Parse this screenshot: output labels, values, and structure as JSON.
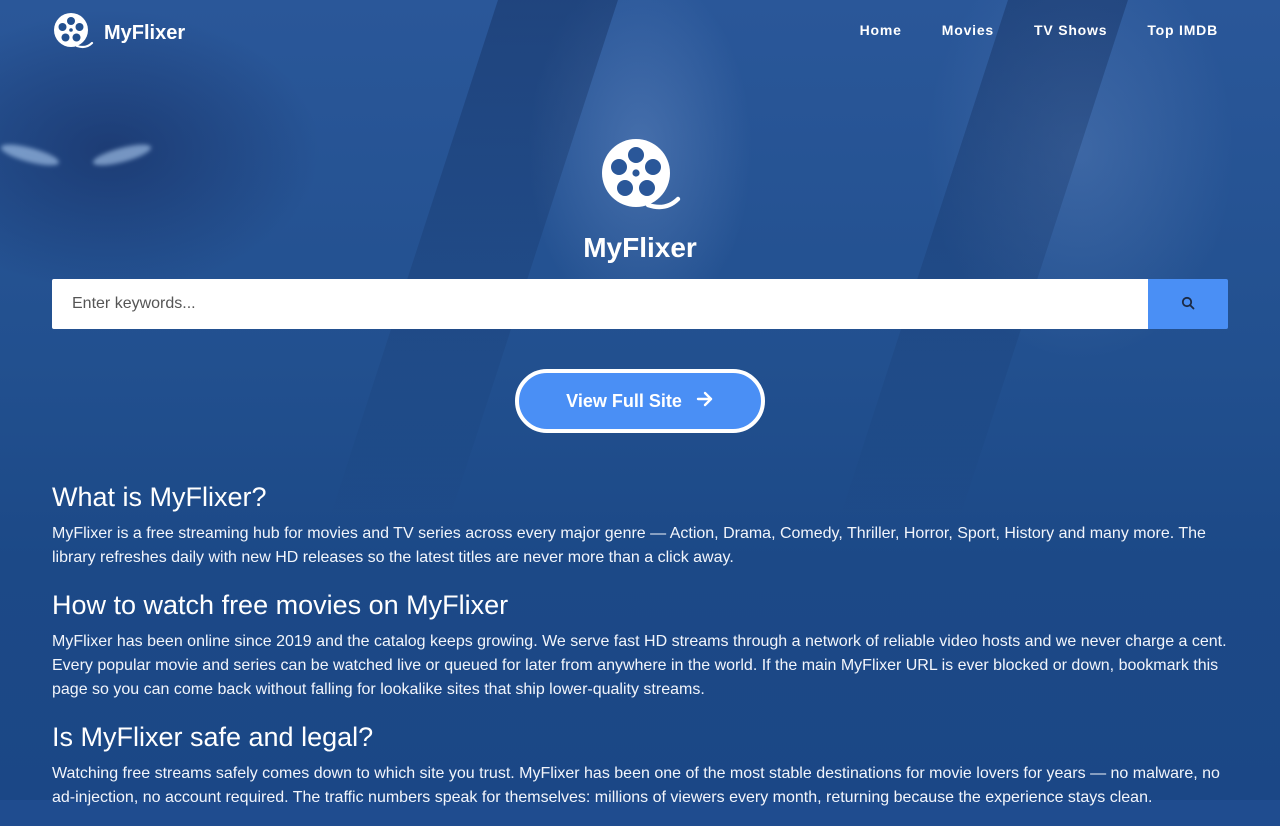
{
  "nav": {
    "brand": "MyFlixer",
    "items": [
      {
        "label": "Home"
      },
      {
        "label": "Movies"
      },
      {
        "label": "TV Shows"
      },
      {
        "label": "Top IMDB"
      }
    ]
  },
  "hero": {
    "title": "MyFlixer",
    "logo_icon": "film-reel-icon"
  },
  "search": {
    "placeholder": "Enter keywords...",
    "value": "",
    "button_icon": "search-icon"
  },
  "cta": {
    "label": "View Full Site",
    "icon": "arrow-right-icon"
  },
  "sections": [
    {
      "heading": "What is MyFlixer?",
      "body": "MyFlixer is a free streaming hub for movies and TV series across every major genre — Action, Drama, Comedy, Thriller, Horror, Sport, History and many more. The library refreshes daily with new HD releases so the latest titles are never more than a click away."
    },
    {
      "heading": "How to watch free movies on MyFlixer",
      "body": "MyFlixer has been online since 2019 and the catalog keeps growing. We serve fast HD streams through a network of reliable video hosts and we never charge a cent. Every popular movie and series can be watched live or queued for later from anywhere in the world. If the main MyFlixer URL is ever blocked or down, bookmark this page so you can come back without falling for lookalike sites that ship lower-quality streams."
    },
    {
      "heading": "Is MyFlixer safe and legal?",
      "body": "Watching free streams safely comes down to which site you trust. MyFlixer has been one of the most stable destinations for movie lovers for years — no malware, no ad-injection, no account required. The traffic numbers speak for themselves: millions of viewers every month, returning because the experience stays clean."
    }
  ],
  "colors": {
    "accent": "#4a8ff5",
    "background": "#22508f",
    "text": "#ffffff"
  }
}
